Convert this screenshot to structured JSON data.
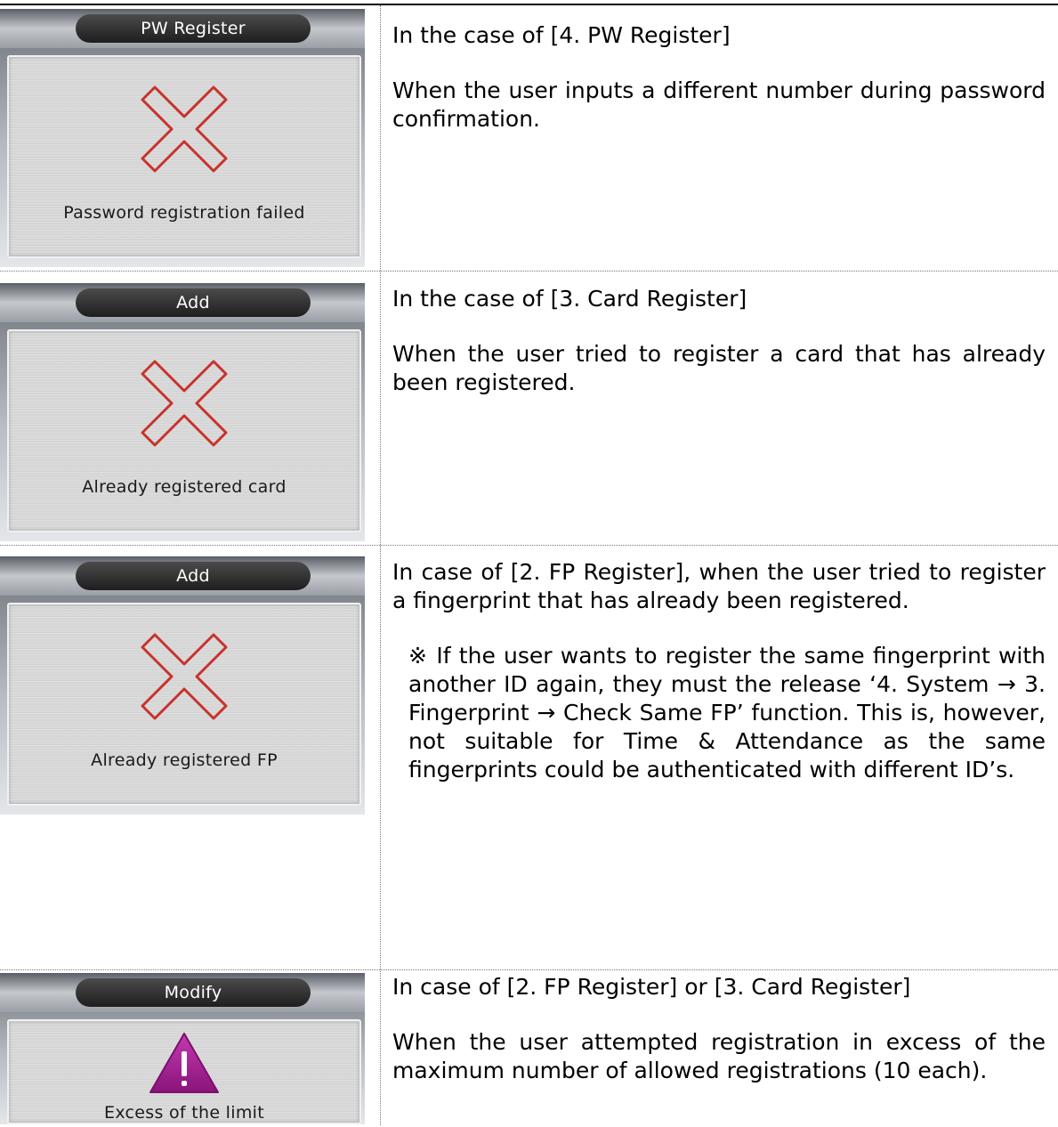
{
  "rows": [
    {
      "screen_title": "PW Register",
      "icon": "x-mark-icon",
      "message": "Password registration failed",
      "case_line": "In the case of [4. PW Register]",
      "description": "When the user inputs a different number during password confirmation."
    },
    {
      "screen_title": "Add",
      "icon": "x-mark-icon",
      "message": "Already registered card",
      "case_line": "In the case of [3. Card Register]",
      "description": "When the user tried to register a card that has already been registered."
    },
    {
      "screen_title": "Add",
      "icon": "x-mark-icon",
      "message": "Already registered FP",
      "case_line": "In case of [2. FP Register], when the user tried to register a fingerprint that has already been registered.",
      "note": "※ If the user wants to register the same fingerprint with another ID again, they must the release ‘4. System → 3. Fingerprint → Check Same FP’ function. This is, however, not suitable for Time & Attendance as the same fingerprints could be authenticated with different ID’s."
    },
    {
      "screen_title": "Modify",
      "icon": "warning-icon",
      "message": "Excess of the limit",
      "case_line": "In case of [2. FP Register] or [3. Card Register]",
      "description": "When the user attempted registration in excess of the maximum number of allowed registrations (10 each)."
    }
  ],
  "colors": {
    "x_mark": "#c8322c",
    "warning": "#9c1a8c"
  }
}
